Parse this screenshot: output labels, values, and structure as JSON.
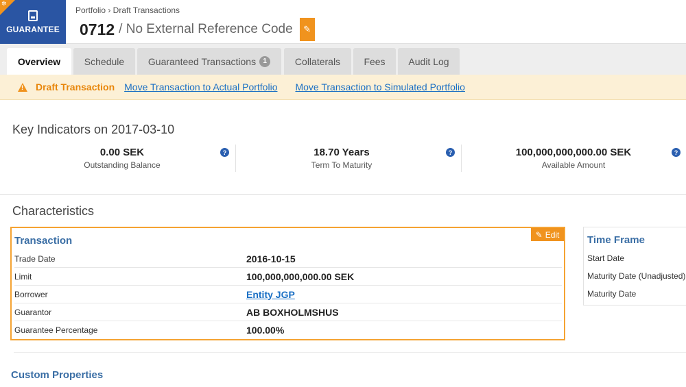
{
  "header": {
    "type_label": "GUARANTEE",
    "breadcrumb": "Portfolio › Draft Transactions",
    "code": "0712",
    "reference": "/ No External Reference Code",
    "accent": "#f0931e",
    "brand": "#2a55a3"
  },
  "tabs": [
    {
      "label": "Overview",
      "active": true
    },
    {
      "label": "Schedule"
    },
    {
      "label": "Guaranteed Transactions",
      "count": "1"
    },
    {
      "label": "Collaterals"
    },
    {
      "label": "Fees"
    },
    {
      "label": "Audit Log"
    }
  ],
  "banner": {
    "status": "Draft Transaction",
    "link_actual": "Move Transaction to Actual Portfolio",
    "link_simulated": "Move Transaction to Simulated Portfolio"
  },
  "key_indicators": {
    "title": "Key Indicators on 2017-03-10",
    "items": [
      {
        "value": "0.00 SEK",
        "caption": "Outstanding Balance"
      },
      {
        "value": "18.70 Years",
        "caption": "Term To Maturity"
      },
      {
        "value": "100,000,000,000.00 SEK",
        "caption": "Available Amount"
      }
    ]
  },
  "characteristics": {
    "title": "Characteristics",
    "transaction": {
      "title": "Transaction",
      "edit_label": "Edit",
      "rows": [
        {
          "key": "Trade Date",
          "value": "2016-10-15"
        },
        {
          "key": "Limit",
          "value": "100,000,000,000.00 SEK"
        },
        {
          "key": "Borrower",
          "value": "Entity JGP"
        },
        {
          "key": "Guarantor",
          "value": "AB BOXHOLMSHUS"
        },
        {
          "key": "Guarantee Percentage",
          "value": "100.00%"
        }
      ]
    },
    "time_frame": {
      "title": "Time Frame",
      "rows": [
        {
          "key": "Start Date"
        },
        {
          "key": "Maturity Date (Unadjusted)"
        },
        {
          "key": "Maturity Date"
        }
      ]
    }
  },
  "custom_properties": {
    "title": "Custom Properties"
  }
}
